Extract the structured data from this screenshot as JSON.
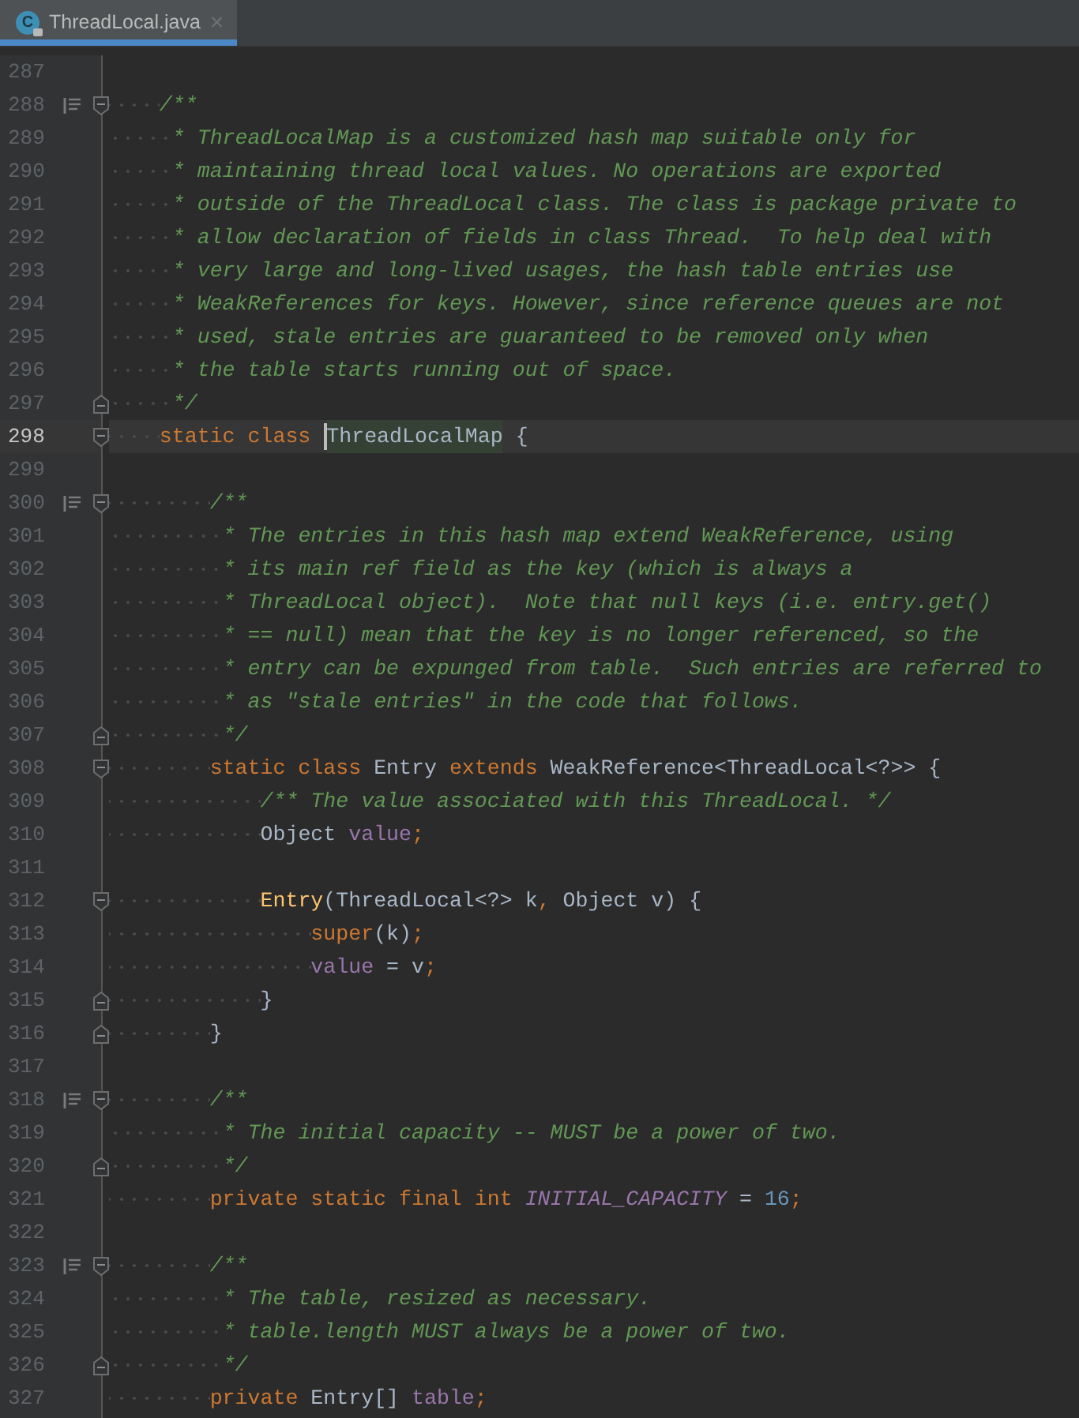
{
  "tab": {
    "icon_text": "C",
    "label": "ThreadLocal.java",
    "close": "×",
    "selected": true
  },
  "lines": [
    {
      "number": "287",
      "fold_start": false,
      "fold_end": false,
      "doc_toggle": false,
      "current": false
    },
    {
      "number": "288",
      "fold_start": true,
      "fold_end": false,
      "doc_toggle": true,
      "current": false,
      "tokens": [
        {
          "kind": "comment",
          "text": "    /**"
        }
      ]
    },
    {
      "number": "289",
      "fold_start": false,
      "fold_end": false,
      "doc_toggle": false,
      "current": false,
      "tokens": [
        {
          "kind": "comment",
          "text": "     * ThreadLocalMap is a customized hash map suitable only for"
        }
      ]
    },
    {
      "number": "290",
      "fold_start": false,
      "fold_end": false,
      "doc_toggle": false,
      "current": false,
      "tokens": [
        {
          "kind": "comment",
          "text": "     * maintaining thread local values. No operations are exported"
        }
      ]
    },
    {
      "number": "291",
      "fold_start": false,
      "fold_end": false,
      "doc_toggle": false,
      "current": false,
      "tokens": [
        {
          "kind": "comment",
          "text": "     * outside of the ThreadLocal class. The class is package private to"
        }
      ]
    },
    {
      "number": "292",
      "fold_start": false,
      "fold_end": false,
      "doc_toggle": false,
      "current": false,
      "tokens": [
        {
          "kind": "comment",
          "text": "     * allow declaration of fields in class Thread.  To help deal with"
        }
      ]
    },
    {
      "number": "293",
      "fold_start": false,
      "fold_end": false,
      "doc_toggle": false,
      "current": false,
      "tokens": [
        {
          "kind": "comment",
          "text": "     * very large and long-lived usages, the hash table entries use"
        }
      ]
    },
    {
      "number": "294",
      "fold_start": false,
      "fold_end": false,
      "doc_toggle": false,
      "current": false,
      "tokens": [
        {
          "kind": "comment",
          "text": "     * WeakReferences for keys. However, since reference queues are not"
        }
      ]
    },
    {
      "number": "295",
      "fold_start": false,
      "fold_end": false,
      "doc_toggle": false,
      "current": false,
      "tokens": [
        {
          "kind": "comment",
          "text": "     * used, stale entries are guaranteed to be removed only when"
        }
      ]
    },
    {
      "number": "296",
      "fold_start": false,
      "fold_end": false,
      "doc_toggle": false,
      "current": false,
      "tokens": [
        {
          "kind": "comment",
          "text": "     * the table starts running out of space."
        }
      ]
    },
    {
      "number": "297",
      "fold_start": false,
      "fold_end": true,
      "doc_toggle": false,
      "current": false,
      "tokens": [
        {
          "kind": "comment",
          "text": "     */"
        }
      ]
    },
    {
      "number": "298",
      "fold_start": true,
      "fold_end": false,
      "doc_toggle": false,
      "current": true,
      "tokens": [
        {
          "kind": "keyword",
          "text": "    static class "
        },
        {
          "kind": "highlight",
          "text": "ThreadLocalMap"
        },
        {
          "kind": "plain",
          "text": " {"
        }
      ]
    },
    {
      "number": "299",
      "fold_start": false,
      "fold_end": false,
      "doc_toggle": false,
      "current": false
    },
    {
      "number": "300",
      "fold_start": true,
      "fold_end": false,
      "doc_toggle": true,
      "current": false,
      "tokens": [
        {
          "kind": "comment",
          "text": "        /**"
        }
      ]
    },
    {
      "number": "301",
      "fold_start": false,
      "fold_end": false,
      "doc_toggle": false,
      "current": false,
      "tokens": [
        {
          "kind": "comment",
          "text": "         * The entries in this hash map extend WeakReference, using"
        }
      ]
    },
    {
      "number": "302",
      "fold_start": false,
      "fold_end": false,
      "doc_toggle": false,
      "current": false,
      "tokens": [
        {
          "kind": "comment",
          "text": "         * its main ref field as the key (which is always a"
        }
      ]
    },
    {
      "number": "303",
      "fold_start": false,
      "fold_end": false,
      "doc_toggle": false,
      "current": false,
      "tokens": [
        {
          "kind": "comment",
          "text": "         * ThreadLocal object).  Note that null keys (i.e. entry.get()"
        }
      ]
    },
    {
      "number": "304",
      "fold_start": false,
      "fold_end": false,
      "doc_toggle": false,
      "current": false,
      "tokens": [
        {
          "kind": "comment",
          "text": "         * == null) mean that the key is no longer referenced, so the"
        }
      ]
    },
    {
      "number": "305",
      "fold_start": false,
      "fold_end": false,
      "doc_toggle": false,
      "current": false,
      "tokens": [
        {
          "kind": "comment",
          "text": "         * entry can be expunged from table.  Such entries are referred to"
        }
      ]
    },
    {
      "number": "306",
      "fold_start": false,
      "fold_end": false,
      "doc_toggle": false,
      "current": false,
      "tokens": [
        {
          "kind": "comment",
          "text": "         * as \"stale entries\" in the code that follows."
        }
      ]
    },
    {
      "number": "307",
      "fold_start": false,
      "fold_end": true,
      "doc_toggle": false,
      "current": false,
      "tokens": [
        {
          "kind": "comment",
          "text": "         */"
        }
      ]
    },
    {
      "number": "308",
      "fold_start": true,
      "fold_end": false,
      "doc_toggle": false,
      "current": false,
      "tokens": [
        {
          "kind": "keyword",
          "text": "        static class "
        },
        {
          "kind": "plain",
          "text": "Entry "
        },
        {
          "kind": "keyword",
          "text": "extends "
        },
        {
          "kind": "plain",
          "text": "WeakReference<ThreadLocal<?>> {"
        }
      ]
    },
    {
      "number": "309",
      "fold_start": false,
      "fold_end": false,
      "doc_toggle": false,
      "current": false,
      "tokens": [
        {
          "kind": "comment",
          "text": "            /** The value associated with this ThreadLocal. */"
        }
      ]
    },
    {
      "number": "310",
      "fold_start": false,
      "fold_end": false,
      "doc_toggle": false,
      "current": false,
      "tokens": [
        {
          "kind": "plain",
          "text": "            Object "
        },
        {
          "kind": "field",
          "text": "value"
        },
        {
          "kind": "keyword",
          "text": ";"
        }
      ]
    },
    {
      "number": "311",
      "fold_start": false,
      "fold_end": false,
      "doc_toggle": false,
      "current": false
    },
    {
      "number": "312",
      "fold_start": true,
      "fold_end": false,
      "doc_toggle": false,
      "current": false,
      "tokens": [
        {
          "kind": "method",
          "text": "            Entry"
        },
        {
          "kind": "plain",
          "text": "(ThreadLocal<?> k"
        },
        {
          "kind": "keyword",
          "text": ","
        },
        {
          "kind": "plain",
          "text": " Object v) {"
        }
      ]
    },
    {
      "number": "313",
      "fold_start": false,
      "fold_end": false,
      "doc_toggle": false,
      "current": false,
      "tokens": [
        {
          "kind": "keyword",
          "text": "                super"
        },
        {
          "kind": "plain",
          "text": "(k)"
        },
        {
          "kind": "keyword",
          "text": ";"
        }
      ]
    },
    {
      "number": "314",
      "fold_start": false,
      "fold_end": false,
      "doc_toggle": false,
      "current": false,
      "tokens": [
        {
          "kind": "field",
          "text": "                value"
        },
        {
          "kind": "plain",
          "text": " = v"
        },
        {
          "kind": "keyword",
          "text": ";"
        }
      ]
    },
    {
      "number": "315",
      "fold_start": false,
      "fold_end": true,
      "doc_toggle": false,
      "current": false,
      "tokens": [
        {
          "kind": "plain",
          "text": "            }"
        }
      ]
    },
    {
      "number": "316",
      "fold_start": false,
      "fold_end": true,
      "doc_toggle": false,
      "current": false,
      "tokens": [
        {
          "kind": "plain",
          "text": "        }"
        }
      ]
    },
    {
      "number": "317",
      "fold_start": false,
      "fold_end": false,
      "doc_toggle": false,
      "current": false
    },
    {
      "number": "318",
      "fold_start": true,
      "fold_end": false,
      "doc_toggle": true,
      "current": false,
      "tokens": [
        {
          "kind": "comment",
          "text": "        /**"
        }
      ]
    },
    {
      "number": "319",
      "fold_start": false,
      "fold_end": false,
      "doc_toggle": false,
      "current": false,
      "tokens": [
        {
          "kind": "comment",
          "text": "         * The initial capacity -- MUST be a power of two."
        }
      ]
    },
    {
      "number": "320",
      "fold_start": false,
      "fold_end": true,
      "doc_toggle": false,
      "current": false,
      "tokens": [
        {
          "kind": "comment",
          "text": "         */"
        }
      ]
    },
    {
      "number": "321",
      "fold_start": false,
      "fold_end": false,
      "doc_toggle": false,
      "current": false,
      "tokens": [
        {
          "kind": "keyword",
          "text": "        private static final int "
        },
        {
          "kind": "constant",
          "text": "INITIAL_CAPACITY"
        },
        {
          "kind": "plain",
          "text": " = "
        },
        {
          "kind": "number",
          "text": "16"
        },
        {
          "kind": "keyword",
          "text": ";"
        }
      ]
    },
    {
      "number": "322",
      "fold_start": false,
      "fold_end": false,
      "doc_toggle": false,
      "current": false
    },
    {
      "number": "323",
      "fold_start": true,
      "fold_end": false,
      "doc_toggle": true,
      "current": false,
      "tokens": [
        {
          "kind": "comment",
          "text": "        /**"
        }
      ]
    },
    {
      "number": "324",
      "fold_start": false,
      "fold_end": false,
      "doc_toggle": false,
      "current": false,
      "tokens": [
        {
          "kind": "comment",
          "text": "         * The table, resized as necessary."
        }
      ]
    },
    {
      "number": "325",
      "fold_start": false,
      "fold_end": false,
      "doc_toggle": false,
      "current": false,
      "tokens": [
        {
          "kind": "comment",
          "text": "         * table.length MUST always be a power of two."
        }
      ]
    },
    {
      "number": "326",
      "fold_start": false,
      "fold_end": true,
      "doc_toggle": false,
      "current": false,
      "tokens": [
        {
          "kind": "comment",
          "text": "         */"
        }
      ]
    },
    {
      "number": "327",
      "fold_start": false,
      "fold_end": false,
      "doc_toggle": false,
      "current": false,
      "tokens": [
        {
          "kind": "keyword",
          "text": "        private "
        },
        {
          "kind": "plain",
          "text": "Entry[] "
        },
        {
          "kind": "field",
          "text": "table"
        },
        {
          "kind": "keyword",
          "text": ";"
        }
      ]
    }
  ]
}
